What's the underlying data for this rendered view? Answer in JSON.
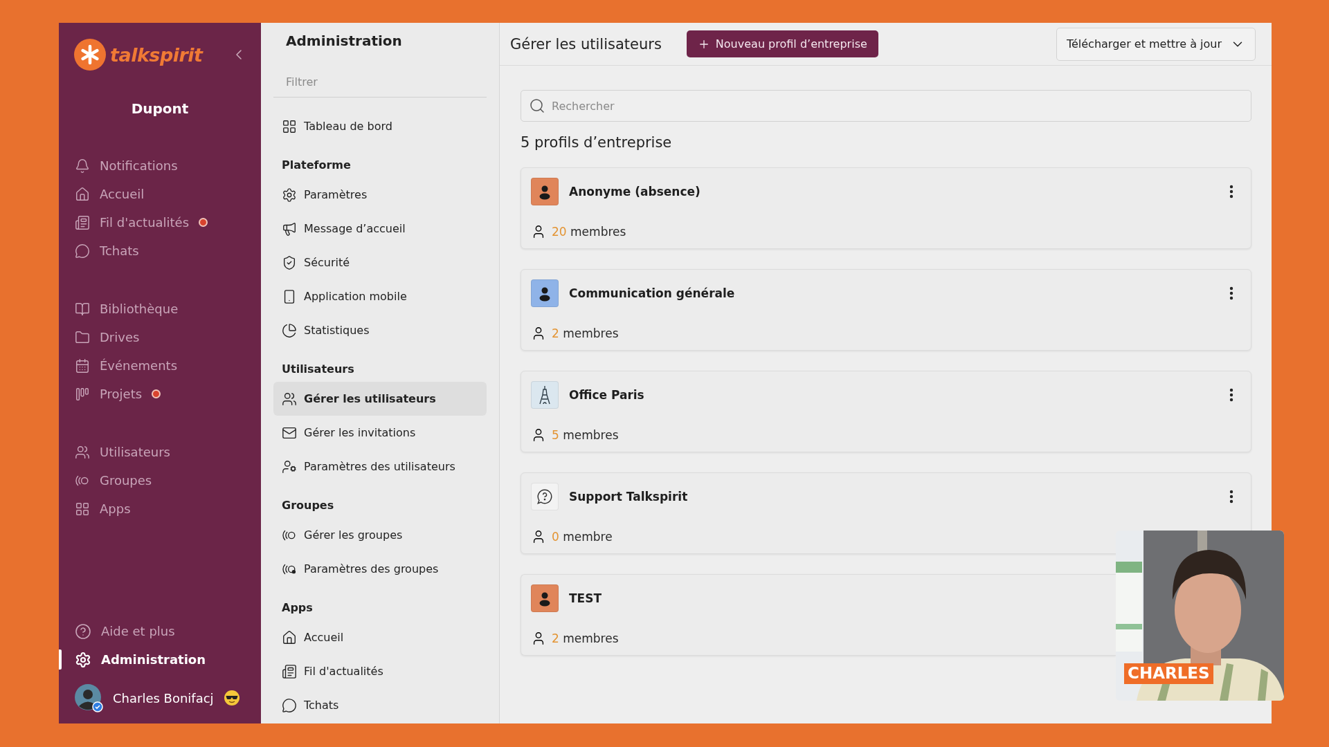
{
  "sidebar": {
    "brand": "talkspirit",
    "workspace": "Dupont",
    "groups": [
      {
        "items": [
          {
            "label": "Notifications",
            "badge": false,
            "selected": false
          },
          {
            "label": "Accueil",
            "badge": false,
            "selected": false
          },
          {
            "label": "Fil d'actualités",
            "badge": true,
            "selected": false
          },
          {
            "label": "Tchats",
            "badge": false,
            "selected": false
          }
        ]
      },
      {
        "items": [
          {
            "label": "Bibliothèque",
            "badge": false,
            "selected": false
          },
          {
            "label": "Drives",
            "badge": false,
            "selected": false
          },
          {
            "label": "Événements",
            "badge": false,
            "selected": false
          },
          {
            "label": "Projets",
            "badge": true,
            "selected": false
          }
        ]
      },
      {
        "items": [
          {
            "label": "Utilisateurs",
            "badge": false,
            "selected": false
          },
          {
            "label": "Groupes",
            "badge": false,
            "selected": false
          },
          {
            "label": "Apps",
            "badge": false,
            "selected": false
          }
        ]
      }
    ],
    "footer_items": [
      {
        "label": "Aide et plus",
        "selected": false
      },
      {
        "label": "Administration",
        "selected": true
      }
    ],
    "user": {
      "name": "Charles Bonifacj"
    }
  },
  "admin_nav": {
    "title": "Administration",
    "filter": {
      "placeholder": "Filtrer"
    },
    "sections": [
      {
        "items": [
          {
            "label": "Tableau de bord",
            "selected": false
          }
        ]
      },
      {
        "heading": "Plateforme",
        "items": [
          {
            "label": "Paramètres",
            "selected": false
          },
          {
            "label": "Message d’accueil",
            "selected": false
          },
          {
            "label": "Sécurité",
            "selected": false
          },
          {
            "label": "Application mobile",
            "selected": false
          },
          {
            "label": "Statistiques",
            "selected": false
          }
        ]
      },
      {
        "heading": "Utilisateurs",
        "items": [
          {
            "label": "Gérer les utilisateurs",
            "selected": true
          },
          {
            "label": "Gérer les invitations",
            "selected": false
          },
          {
            "label": "Paramètres des utilisateurs",
            "selected": false
          }
        ]
      },
      {
        "heading": "Groupes",
        "items": [
          {
            "label": "Gérer les groupes",
            "selected": false
          },
          {
            "label": "Paramètres des groupes",
            "selected": false
          }
        ]
      },
      {
        "heading": "Apps",
        "items": [
          {
            "label": "Accueil",
            "selected": false
          },
          {
            "label": "Fil d'actualités",
            "selected": false
          },
          {
            "label": "Tchats",
            "selected": false
          }
        ]
      }
    ]
  },
  "main": {
    "title": "Gérer les utilisateurs",
    "new_button": "Nouveau profil d’entreprise",
    "download_button": "Télécharger et mettre à jour",
    "search": {
      "placeholder": "Rechercher"
    },
    "count": "5 profils d’entreprise",
    "profiles": [
      {
        "name": "Anonyme (absence)",
        "kind": "person",
        "color": "#e0855a",
        "count": "20",
        "unit": "membres"
      },
      {
        "name": "Communication générale",
        "kind": "person",
        "color": "#8fb3e8",
        "count": "2",
        "unit": "membres"
      },
      {
        "name": "Office Paris",
        "kind": "landmark",
        "color": "#dbe7ef",
        "count": "5",
        "unit": "membres"
      },
      {
        "name": "Support Talkspirit",
        "kind": "support",
        "color": "#f3f3f3",
        "count": "0",
        "unit": "membre"
      },
      {
        "name": "TEST",
        "kind": "person",
        "color": "#e0855a",
        "count": "2",
        "unit": "membres"
      }
    ]
  },
  "video_overlay": {
    "kind": "picture",
    "caption": "CHARLES"
  }
}
